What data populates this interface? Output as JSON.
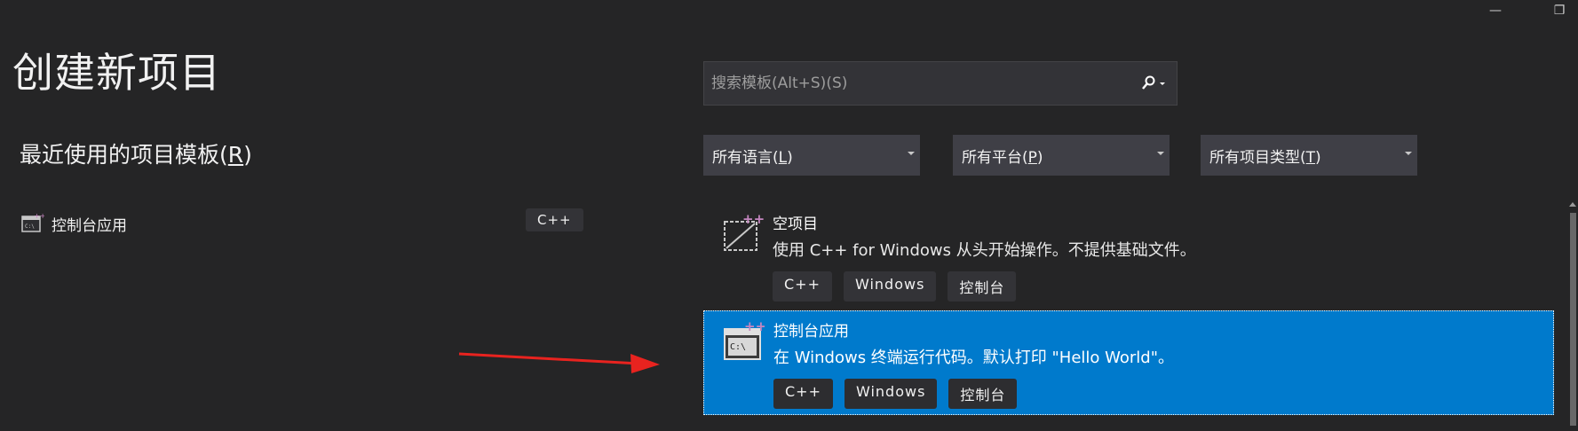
{
  "window": {
    "minimize_glyph": "—",
    "restore_glyph": "❐"
  },
  "page_title": "创建新项目",
  "recent": {
    "title_prefix": "最近使用的项目模板(",
    "title_mnemonic": "R",
    "title_suffix": ")",
    "items": [
      {
        "label": "控制台应用",
        "tag": "C++",
        "icon": "console-app-icon"
      }
    ]
  },
  "search": {
    "placeholder": "搜索模板(Alt+S)(S)",
    "icon": "search-icon"
  },
  "filters": [
    {
      "prefix": "所有语言(",
      "mnemonic": "L",
      "suffix": ")"
    },
    {
      "prefix": "所有平台(",
      "mnemonic": "P",
      "suffix": ")"
    },
    {
      "prefix": "所有项目类型(",
      "mnemonic": "T",
      "suffix": ")"
    }
  ],
  "templates": [
    {
      "title": "空项目",
      "description": "使用 C++ for Windows 从头开始操作。不提供基础文件。",
      "tags": [
        "C++",
        "Windows",
        "控制台"
      ],
      "icon": "empty-project-icon",
      "selected": false
    },
    {
      "title": "控制台应用",
      "description": "在 Windows 终端运行代码。默认打印 \"Hello World\"。",
      "tags": [
        "C++",
        "Windows",
        "控制台"
      ],
      "icon": "console-app-icon",
      "selected": true
    }
  ],
  "colors": {
    "accent": "#007acc",
    "background": "#252526",
    "annotation_arrow": "#e8231f"
  }
}
